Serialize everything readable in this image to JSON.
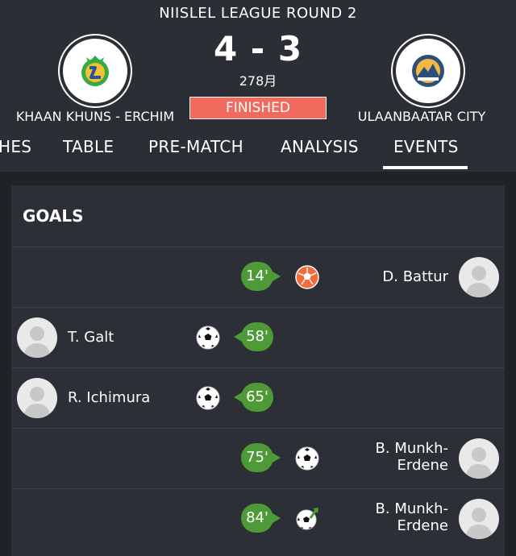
{
  "header": {
    "league_round": "NIISLEL LEAGUE ROUND 2",
    "home_team": "KHAAN KHUNS - ERCHIM",
    "away_team": "ULAANBAATAR CITY",
    "score": "4 - 3",
    "date": "278月",
    "status": "FINISHED",
    "home_logo_icon": "khaan-khuns-erchim-crest",
    "away_logo_icon": "ulaanbaatar-city-crest"
  },
  "tabs": [
    {
      "label": "HES",
      "active": false
    },
    {
      "label": "TABLE",
      "active": false
    },
    {
      "label": "PRE-MATCH",
      "active": false
    },
    {
      "label": "ANALYSIS",
      "active": false
    },
    {
      "label": "EVENTS",
      "active": true
    }
  ],
  "goals": {
    "title": "GOALS",
    "events": [
      {
        "minute": "14'",
        "side": "away",
        "player": "D. Battur",
        "icon": "own-goal-ball-icon"
      },
      {
        "minute": "58'",
        "side": "home",
        "player": "T. Galt",
        "icon": "soccer-ball-icon"
      },
      {
        "minute": "65'",
        "side": "home",
        "player": "R. Ichimura",
        "icon": "soccer-ball-icon"
      },
      {
        "minute": "75'",
        "side": "away",
        "player_line1": "B. Munkh-",
        "player_line2": "Erdene",
        "icon": "soccer-ball-icon"
      },
      {
        "minute": "84'",
        "side": "away",
        "player_line1": "B. Munkh-",
        "player_line2": "Erdene",
        "icon": "soccer-ball-assist-icon"
      }
    ]
  },
  "colors": {
    "background": "#1f2328",
    "header": "#2b2f35",
    "card": "#2c3036",
    "status_badge": "#f06b5e",
    "minute_badge": "#4e9a37",
    "own_goal": "#f26b3a"
  }
}
